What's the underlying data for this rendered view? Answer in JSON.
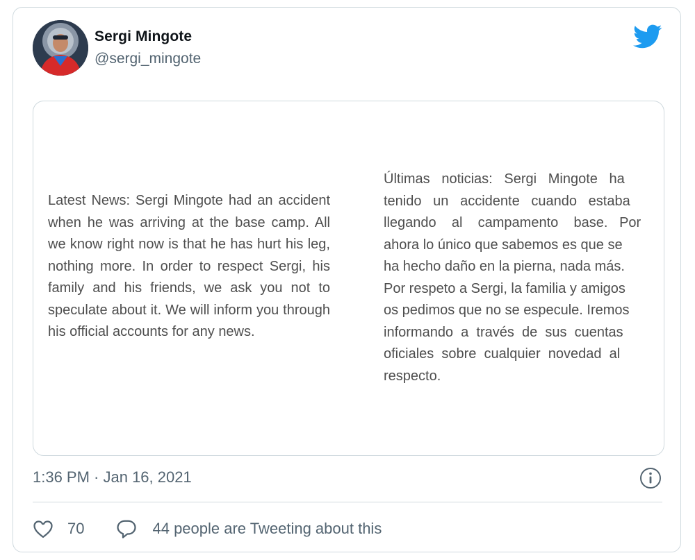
{
  "tweet": {
    "author": {
      "name": "Sergi Mingote",
      "handle": "@sergi_mingote",
      "avatar_icon": "profile-photo"
    },
    "brand_icon": "twitter-bird-icon",
    "brand_color": "#1d9bf0",
    "image": {
      "statement_en": "Latest News: Sergi Mingote had an accident when he was arriving at the base camp. All we know right now is that he has hurt his leg, nothing more. In order to respect Sergi, his family and his friends, we ask you not to speculate about it. We will inform you through his official accounts for any news.",
      "statement_es": "Últimas   noticias:   Sergi   Mingote   ha\ntenido   un   accidente   cuando   estaba\nllegando    al    campamento    base.   Por\nahora lo único que sabemos es que se\nha hecho daño en la pierna, nada más.\nPor respeto a Sergi, la familia y amigos\nos pedimos que no se especule. Iremos\ninformando  a  través  de  sus  cuentas\noficiales  sobre  cualquier  novedad  al\nrespecto."
    },
    "timestamp": "1:36 PM · Jan 16, 2021",
    "info_icon": "info-icon",
    "likes": "70",
    "conversation": "44 people are Tweeting about this"
  }
}
